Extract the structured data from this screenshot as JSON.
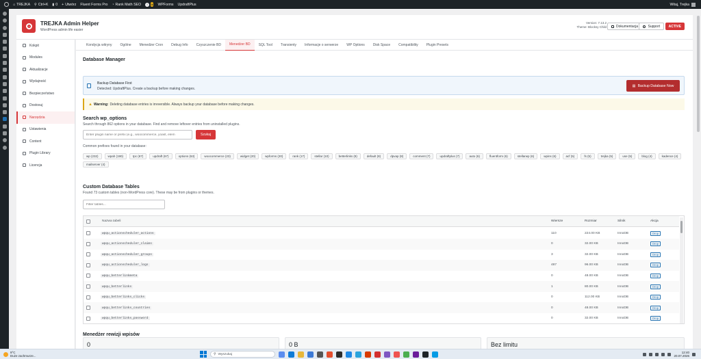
{
  "admin_bar": {
    "site": "TREJKA",
    "shortcut": "Ctrl+K",
    "comments": "0",
    "new": "Utwórz",
    "items": [
      "Fluent Forms Pro",
      "Rank Math SEO",
      "WPForms",
      "UpdraftPlus"
    ],
    "greeting": "Witaj, Trejka"
  },
  "header": {
    "title": "TREJKA Admin Helper",
    "subtitle": "WordPress admin life easier",
    "version": "Version: 7.13.2",
    "theme": "Theme: Blocksy Child",
    "docs_label": "Dokumentacja",
    "support_label": "Support",
    "status": "ACTIVE"
  },
  "sidebar": {
    "items": [
      {
        "label": "Kokpit",
        "icon": "dashboard-icon"
      },
      {
        "label": "Modules",
        "icon": "modules-icon"
      },
      {
        "label": "Aktualizacje",
        "icon": "refresh-icon"
      },
      {
        "label": "Wydajność",
        "icon": "performance-icon"
      },
      {
        "label": "Bezpieczeństwo",
        "icon": "shield-icon"
      },
      {
        "label": "Dostosuj",
        "icon": "customize-icon"
      },
      {
        "label": "Narzędzia",
        "icon": "wrench-icon"
      },
      {
        "label": "Ustawienia",
        "icon": "settings-icon"
      },
      {
        "label": "Content",
        "icon": "content-icon"
      },
      {
        "label": "Plugin Library",
        "icon": "library-icon"
      },
      {
        "label": "Licencja",
        "icon": "key-icon"
      }
    ],
    "current_index": 6
  },
  "tabs": {
    "items": [
      "Kondycja witryny",
      "Ogólne",
      "Menedżer Cron",
      "Debug Info",
      "Czyszczenie BD",
      "Menedżer BD",
      "SQL Tool",
      "Transienty",
      "Informacje o serwerze",
      "WP Options",
      "Disk Space",
      "Compatibility",
      "Plugin Presets"
    ],
    "current_index": 5
  },
  "db_manager": {
    "title": "Database Manager",
    "backup_title": "Backup Database First",
    "backup_text": "Detected: UpdraftPlus. Create a backup before making changes.",
    "backup_button": "Backup Database Now",
    "warning_bold": "Warning:",
    "warning_text": "Deleting database entries is irreversible. Always backup your database before making changes."
  },
  "search": {
    "title": "Search wp_options",
    "description": "Search through 862 options in your database. Find and remove leftover entries from uninstalled plugins.",
    "placeholder": "Enter plugin name or prefix (e.g., woocommerce, yoast, elem",
    "button": "Szukaj",
    "prefixes_label": "Common prefixes found in your database:",
    "prefixes": [
      "wp (232)",
      "wpah (190)",
      "tpc (67)",
      "updraft (67)",
      "options (63)",
      "woocommerce (23)",
      "widget (20)",
      "wpforms (20)",
      "rank (17)",
      "stellar (10)",
      "betterlinks (8)",
      "default (8)",
      "dpvap (8)",
      "comment (7)",
      "updraftplus (7)",
      "auto (6)",
      "fluentform (6)",
      "stellarwp (6)",
      "wpins (6)",
      "acf (5)",
      "fs (5)",
      "trejka (5)",
      "use (5)",
      "blog (4)",
      "kadence (4)",
      "mailserver (4)"
    ]
  },
  "custom_tables": {
    "title": "Custom Database Tables",
    "description": "Found 73 custom tables (non-WordPress core). These may be from plugins or themes.",
    "filter_placeholder": "Filter tables...",
    "columns": {
      "name": "Nazwa tabeli",
      "rows": "Wiersze",
      "size": "Rozmiar",
      "engine": "Silnik",
      "action": "Akcja"
    },
    "drop_label": "Drop",
    "rows": [
      {
        "name": "wpqu_actionscheduler_actions",
        "rows": "110",
        "size": "224.00 KB",
        "engine": "InnoDB"
      },
      {
        "name": "wpqu_actionscheduler_claims",
        "rows": "0",
        "size": "32.00 KB",
        "engine": "InnoDB"
      },
      {
        "name": "wpqu_actionscheduler_groups",
        "rows": "3",
        "size": "32.00 KB",
        "engine": "InnoDB"
      },
      {
        "name": "wpqu_actionscheduler_logs",
        "rows": "487",
        "size": "96.00 KB",
        "engine": "InnoDB"
      },
      {
        "name": "wpqu_betterlinkmeta",
        "rows": "0",
        "size": "48.00 KB",
        "engine": "InnoDB"
      },
      {
        "name": "wpqu_betterlinks",
        "rows": "1",
        "size": "80.00 KB",
        "engine": "InnoDB"
      },
      {
        "name": "wpqu_betterlinks_clicks",
        "rows": "0",
        "size": "112.00 KB",
        "engine": "InnoDB"
      },
      {
        "name": "wpqu_betterlinks_countries",
        "rows": "0",
        "size": "48.00 KB",
        "engine": "InnoDB"
      },
      {
        "name": "wpqu_betterlinks_password",
        "rows": "0",
        "size": "32.00 KB",
        "engine": "InnoDB"
      }
    ]
  },
  "revisions": {
    "title": "Menedżer rewizji wpisów",
    "card1": "0",
    "card2": "0 B",
    "card3": "Bez limitu"
  },
  "taskbar": {
    "temp": "9°C",
    "weather": "Duże zachmurze...",
    "search": "Wyszukaj",
    "time": "12:40",
    "date": "20.07.2026"
  }
}
